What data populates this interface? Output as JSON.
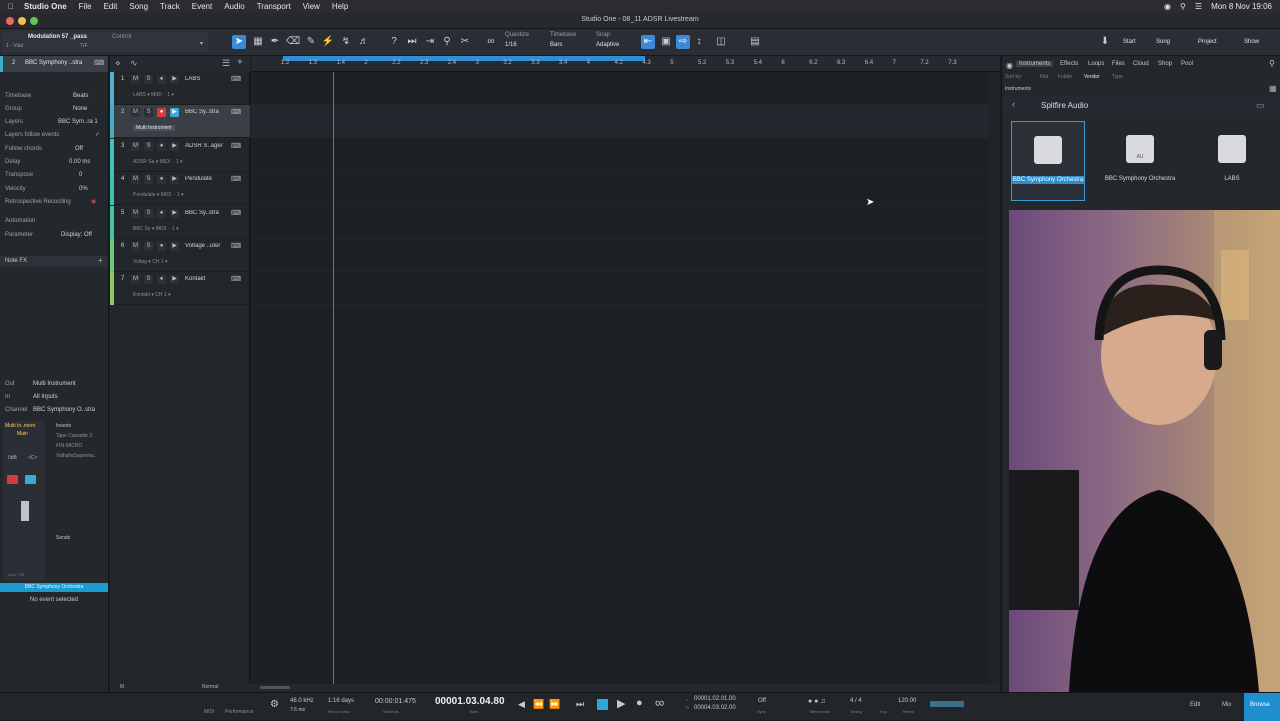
{
  "menubar": {
    "app_name": "Studio One",
    "items": [
      "File",
      "Edit",
      "Song",
      "Track",
      "Event",
      "Audio",
      "Transport",
      "View",
      "Help"
    ],
    "clock": "Mon 8 Nov 19:06"
  },
  "window": {
    "title": "Studio One - 08_11 ADSR Livestream"
  },
  "toolbar": {
    "preset": "Modulation 57 _pass",
    "control": "Control",
    "instrument_short": "1 - Vital",
    "tf": "T/F",
    "quantize_label": "Quantize",
    "quantize_value": "1/16",
    "timebase_label": "Timebase",
    "timebase_value": "Bars",
    "snap_label": "Snap",
    "snap_value": "Adaptive",
    "start": "Start",
    "song": "Song",
    "project": "Project",
    "show": "Show"
  },
  "inspector": {
    "track_num": "2",
    "track_name": "BBC Symphony ..stra",
    "rows": [
      {
        "label": "Timebase",
        "value": "Beats"
      },
      {
        "label": "Group",
        "value": "None"
      },
      {
        "label": "Layers",
        "value": "BBC Sym..ra 1"
      },
      {
        "label": "Layers follow events",
        "value": ""
      },
      {
        "label": "Follow chords",
        "value": "Off"
      },
      {
        "label": "Delay",
        "value": "0.00 ms"
      },
      {
        "label": "Transpose",
        "value": "0"
      },
      {
        "label": "Velocity",
        "value": "0%"
      },
      {
        "label": "Retrospective Recording",
        "value": ""
      }
    ],
    "automation": "Automation",
    "parameter": "Parameter",
    "display": "Display: Off",
    "note_fx": "Note FX",
    "io": [
      {
        "label": "Out",
        "value": "Multi Instrument"
      },
      {
        "label": "In",
        "value": "All Inputs"
      },
      {
        "label": "Channel",
        "value": "BBC Symphony O..stra"
      }
    ],
    "channel_name": "Multi In..ment",
    "channel_sub": "Main",
    "vol": "0dB",
    "pan": "<C>",
    "inserts_label": "Inserts",
    "inserts": [
      "Tape Cassette 2",
      "FIN-MICRO",
      "ValhallaSuperma.."
    ],
    "sends_label": "Sends",
    "auto_off": "Auto: Off",
    "footer_name": "BBC Symphony Orchestra",
    "no_event": "No event selected"
  },
  "tracks": [
    {
      "num": "1",
      "name": "LABS",
      "input": "LABS ▾  MIDI ∙∙ 1 ▾",
      "color": "#4fb3c9"
    },
    {
      "num": "2",
      "name": "BBC Sy..stra",
      "input": "Multi Instrument",
      "color": "#3fb0c8",
      "selected": true
    },
    {
      "num": "3",
      "name": "ADSR S..ager",
      "input": "ADSR Sa ▾  MIDI ∙∙ 1 ▾",
      "color": "#47c1b5"
    },
    {
      "num": "4",
      "name": "Pendulate",
      "input": "Pendulate ▾  MIDI ∙∙ 1 ▾",
      "color": "#3fc2ad"
    },
    {
      "num": "5",
      "name": "BBC Sy..stra",
      "input": "BBC Sy ▾  MIDI ∙∙ 1 ▾",
      "color": "#49c39a"
    },
    {
      "num": "6",
      "name": "Voltage ..uter",
      "input": "Voltag ▾  CH 1 ▾",
      "color": "#6cc77b"
    },
    {
      "num": "7",
      "name": "Kontakt",
      "input": "Kontakt ▾  CH 1 ▾",
      "color": "#8ac76a"
    }
  ],
  "ruler": [
    "1.2",
    "1.3",
    "1.4",
    "2",
    "2.2",
    "2.3",
    "2.4",
    "3",
    "3.2",
    "3.3",
    "3.4",
    "4",
    "4.2",
    "4.3",
    "5",
    "5.2",
    "5.3",
    "5.4",
    "6",
    "6.2",
    "6.3",
    "6.4",
    "7",
    "7.2",
    "7.3"
  ],
  "browser": {
    "tabs": [
      "Instruments",
      "Effects",
      "Loops",
      "Files",
      "Cloud",
      "Shop",
      "Pool"
    ],
    "sort_by": "Sort by:",
    "sort_options": [
      "Flat",
      "Folder",
      "Vendor",
      "Type"
    ],
    "breadcrumb": "Instruments",
    "vendor": "Spitfire Audio",
    "instruments": [
      {
        "name": "BBC Symphony Orchestra",
        "badge": ""
      },
      {
        "name": "BBC Symphony Orchestra",
        "badge": "AU"
      },
      {
        "name": "LABS",
        "badge": ""
      }
    ]
  },
  "transport": {
    "midi": "MIDI",
    "performance": "Performance",
    "sample_rate": "48.0 kHz",
    "latency": "7.6 ms",
    "record_max": "1:16 days",
    "record_max_label": "Record Max",
    "seconds": "00:00:01.475",
    "seconds_label": "Seconds",
    "position": "00001.03.04.80",
    "bars_label": "Bars",
    "loop_l": "00001.02.01.00",
    "loop_r": "00004.03.02.00",
    "sync": "Off",
    "sync_label": "Sync",
    "metronome_label": "Metronome",
    "time_sig": "4 / 4",
    "timing_label": "Timing",
    "key_label": "Key",
    "tempo": "120.00",
    "tempo_label": "Tempo",
    "edit": "Edit",
    "mix": "Mix",
    "browse": "Browse",
    "normal": "Normal"
  }
}
